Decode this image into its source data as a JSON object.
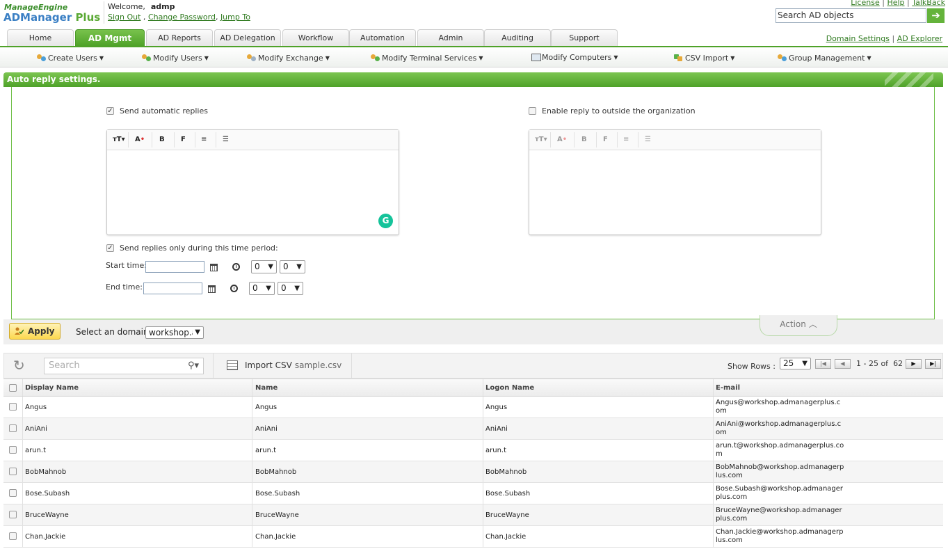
{
  "header": {
    "logo_top": "ManageEngine",
    "logo_main_a": "ADManager",
    "logo_main_b": " Plus",
    "welcome": "Welcome,",
    "user": "admp",
    "sign_out": "Sign Out",
    "change_password": "Change Password",
    "jump_to": "Jump To",
    "top_links": [
      "License",
      "Help",
      "TalkBack"
    ],
    "search_value": "Search AD objects",
    "domain_settings": "Domain Settings",
    "ad_explorer": "AD Explorer"
  },
  "tabs": [
    "Home",
    "AD Mgmt",
    "AD Reports",
    "AD Delegation",
    "Workflow",
    "Automation",
    "Admin",
    "Auditing",
    "Support"
  ],
  "active_tab": "AD Mgmt",
  "submenu": [
    "Create Users",
    "Modify Users",
    "Modify Exchange",
    "Modify Terminal Services",
    "Modify Computers",
    "CSV Import",
    "Group Management"
  ],
  "panel": {
    "title": "Auto reply settings.",
    "send_auto_label": "Send automatic replies",
    "send_auto_checked": true,
    "outside_label": "Enable reply to outside the organization",
    "outside_checked": false,
    "time_period_label": "Send replies only during this time period:",
    "time_period_checked": true,
    "start_label": "Start time:",
    "end_label": "End time:",
    "start_hour": "0",
    "start_min": "0",
    "end_hour": "0",
    "end_min": "0",
    "editor_buttons": [
      "TT",
      "A",
      "B",
      "F",
      "≡",
      "☰"
    ]
  },
  "action_bar": {
    "apply": "Apply",
    "domain_label": "Select an domain",
    "domain_value": "workshop.a",
    "action": "Action"
  },
  "grid": {
    "search_placeholder": "Search",
    "import_label": "Import CSV",
    "import_file": "sample.csv",
    "show_rows_label": "Show Rows :",
    "rows_value": "25",
    "range": "1 - 25 of",
    "total": "62",
    "columns": [
      "Display Name",
      "Name",
      "Logon Name",
      "E-mail"
    ],
    "rows": [
      {
        "display": "Angus",
        "name": "Angus",
        "logon": "Angus",
        "email": "Angus@workshop.admanagerplus.com"
      },
      {
        "display": "AniAni",
        "name": "AniAni",
        "logon": "AniAni",
        "email": "AniAni@workshop.admanagerplus.com"
      },
      {
        "display": "arun.t",
        "name": "arun.t",
        "logon": "arun.t",
        "email": "arun.t@workshop.admanagerplus.com"
      },
      {
        "display": "BobMahnob",
        "name": "BobMahnob",
        "logon": "BobMahnob",
        "email": "BobMahnob@workshop.admanagerplus.com"
      },
      {
        "display": "Bose.Subash",
        "name": "Bose.Subash",
        "logon": "Bose.Subash",
        "email": "Bose.Subash@workshop.admanagerplus.com"
      },
      {
        "display": "BruceWayne",
        "name": "BruceWayne",
        "logon": "BruceWayne",
        "email": "BruceWayne@workshop.admanagerplus.com"
      },
      {
        "display": "Chan.Jackie",
        "name": "Chan.Jackie",
        "logon": "Chan.Jackie",
        "email": "Chan.Jackie@workshop.admanagerplus.com"
      }
    ]
  },
  "colors": {
    "accent": "#4fa229",
    "brand_blue": "#3a7fc4",
    "apply": "#fcd84f"
  }
}
